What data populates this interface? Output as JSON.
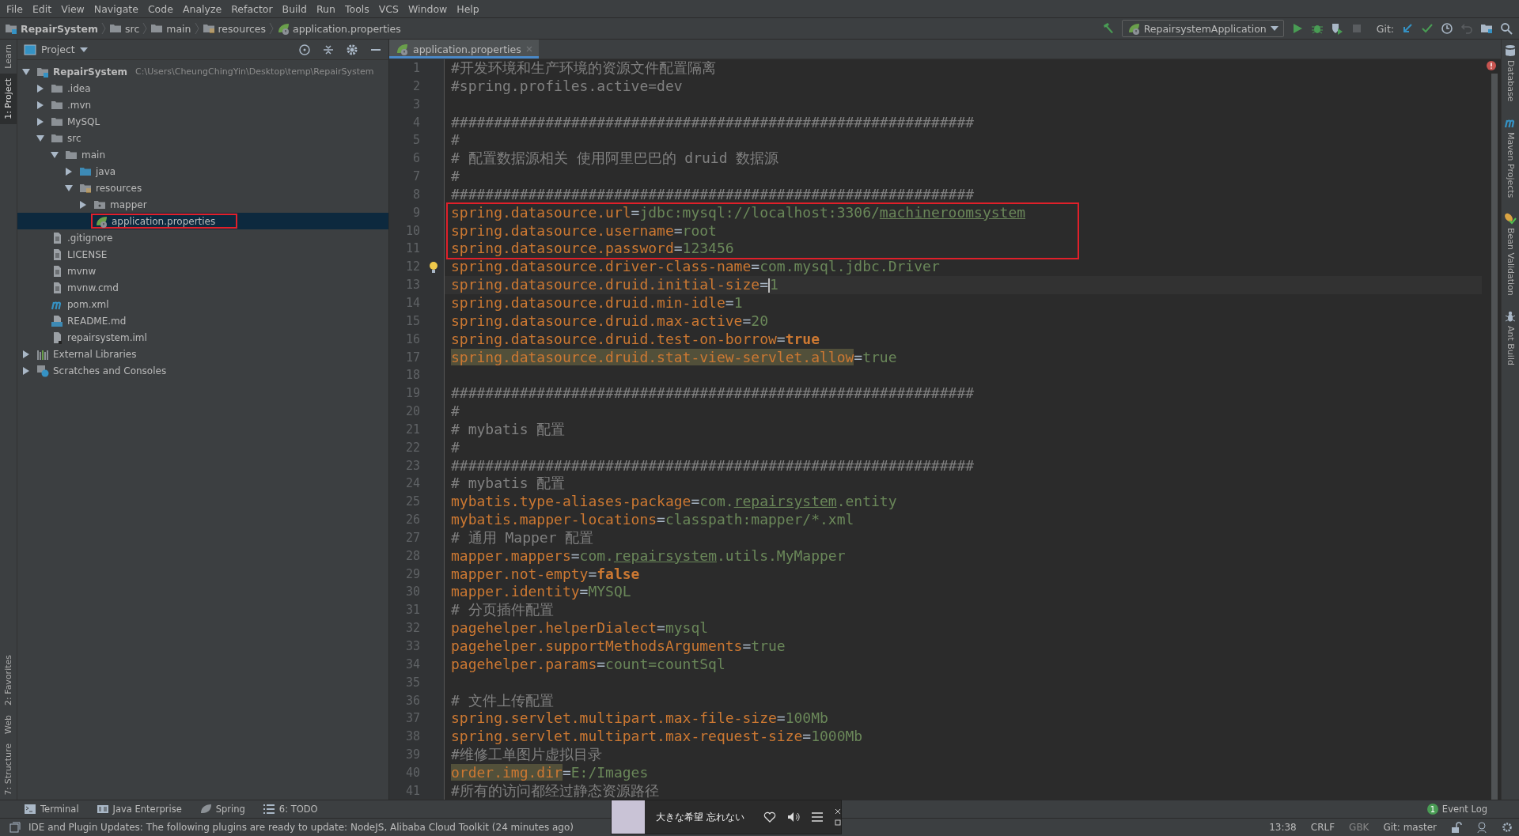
{
  "menu": [
    "File",
    "Edit",
    "View",
    "Navigate",
    "Code",
    "Analyze",
    "Refactor",
    "Build",
    "Run",
    "Tools",
    "VCS",
    "Window",
    "Help"
  ],
  "breadcrumbs": [
    {
      "label": "RepairSystem",
      "kind": "module"
    },
    {
      "label": "src",
      "kind": "folder"
    },
    {
      "label": "main",
      "kind": "folder"
    },
    {
      "label": "resources",
      "kind": "resource-folder"
    },
    {
      "label": "application.properties",
      "kind": "spring-file"
    }
  ],
  "toolbar": {
    "run_config": "RepairsystemApplication",
    "git_label": "Git:"
  },
  "left_stripe": [
    {
      "label": "Learn",
      "selected": false
    },
    {
      "label": "1: Project",
      "selected": true
    },
    {
      "label": "2: Favorites",
      "selected": false
    },
    {
      "label": "Web",
      "selected": false
    },
    {
      "label": "7: Structure",
      "selected": false
    }
  ],
  "project_panel": {
    "title": "Project",
    "tree": [
      {
        "label": "RepairSystem",
        "path": "C:\\Users\\CheungChingYin\\Desktop\\temp\\RepairSystem",
        "kind": "module",
        "expanded": true,
        "selected": false,
        "children": [
          {
            "label": ".idea",
            "kind": "folder",
            "expanded": false,
            "selected": false
          },
          {
            "label": ".mvn",
            "kind": "folder",
            "expanded": false,
            "selected": false
          },
          {
            "label": "MySQL",
            "kind": "folder",
            "expanded": false,
            "selected": false
          },
          {
            "label": "src",
            "kind": "folder",
            "expanded": true,
            "selected": false,
            "children": [
              {
                "label": "main",
                "kind": "folder",
                "expanded": true,
                "selected": false,
                "children": [
                  {
                    "label": "java",
                    "kind": "source-folder",
                    "expanded": false,
                    "selected": false
                  },
                  {
                    "label": "resources",
                    "kind": "resource-folder",
                    "expanded": true,
                    "selected": false,
                    "children": [
                      {
                        "label": "mapper",
                        "kind": "package-folder",
                        "expanded": false,
                        "selected": false
                      },
                      {
                        "label": "application.properties",
                        "kind": "spring-file",
                        "selected": true,
                        "boxed": true
                      }
                    ]
                  }
                ]
              }
            ]
          },
          {
            "label": ".gitignore",
            "kind": "file",
            "selected": false
          },
          {
            "label": "LICENSE",
            "kind": "file",
            "selected": false
          },
          {
            "label": "mvnw",
            "kind": "file",
            "selected": false
          },
          {
            "label": "mvnw.cmd",
            "kind": "file",
            "selected": false
          },
          {
            "label": "pom.xml",
            "kind": "maven",
            "selected": false
          },
          {
            "label": "README.md",
            "kind": "md",
            "selected": false
          },
          {
            "label": "repairsystem.iml",
            "kind": "iml",
            "selected": false
          }
        ]
      },
      {
        "label": "External Libraries",
        "kind": "libraries",
        "expanded": false,
        "selected": false
      },
      {
        "label": "Scratches and Consoles",
        "kind": "scratches",
        "expanded": false,
        "selected": false
      }
    ]
  },
  "editor": {
    "tabs": [
      {
        "label": "application.properties",
        "selected": true
      }
    ],
    "lines": [
      {
        "number": "1",
        "parts": [
          {
            "text": "#开发环境和生产环境的资源文件配置隔离",
            "kind": "comment"
          }
        ]
      },
      {
        "number": "2",
        "parts": [
          {
            "text": "#spring.profiles.active=dev",
            "kind": "comment"
          }
        ]
      },
      {
        "number": "3"
      },
      {
        "number": "4",
        "parts": [
          {
            "text": "#############################################################",
            "kind": "comment"
          }
        ]
      },
      {
        "number": "5",
        "parts": [
          {
            "text": "#",
            "kind": "comment"
          }
        ]
      },
      {
        "number": "6",
        "parts": [
          {
            "text": "# 配置数据源相关 使用阿里巴巴的 druid 数据源",
            "kind": "comment"
          }
        ]
      },
      {
        "number": "7",
        "parts": [
          {
            "text": "#",
            "kind": "comment"
          }
        ]
      },
      {
        "number": "8",
        "parts": [
          {
            "text": "#############################################################",
            "kind": "comment"
          }
        ]
      },
      {
        "number": "9",
        "boxed": true,
        "parts": [
          {
            "text": "spring.datasource.url",
            "kind": "key"
          },
          {
            "text": "=",
            "kind": "sep"
          },
          {
            "text": "jdbc:mysql://localhost:3306/",
            "kind": "value"
          },
          {
            "text": "machineroomsystem",
            "kind": "underlined"
          }
        ]
      },
      {
        "number": "10",
        "boxed": true,
        "parts": [
          {
            "text": "spring.datasource.username",
            "kind": "key"
          },
          {
            "text": "=",
            "kind": "sep"
          },
          {
            "text": "root",
            "kind": "value"
          }
        ]
      },
      {
        "number": "11",
        "boxed": true,
        "parts": [
          {
            "text": "spring.datasource.password",
            "kind": "key"
          },
          {
            "text": "=",
            "kind": "sep"
          },
          {
            "text": "123456",
            "kind": "value"
          }
        ]
      },
      {
        "number": "12",
        "bulb": true,
        "parts": [
          {
            "text": "spring.datasource.driver-class-name",
            "kind": "key"
          },
          {
            "text": "=",
            "kind": "sep"
          },
          {
            "text": "com.mysql.jdbc.Driver",
            "kind": "value"
          }
        ]
      },
      {
        "number": "13",
        "current": true,
        "parts": [
          {
            "text": "spring.datasource.druid.initial-size",
            "kind": "key"
          },
          {
            "text": "=",
            "kind": "sep"
          },
          {
            "text": "1",
            "kind": "value"
          }
        ]
      },
      {
        "number": "14",
        "parts": [
          {
            "text": "spring.datasource.druid.min-idle",
            "kind": "key"
          },
          {
            "text": "=",
            "kind": "sep"
          },
          {
            "text": "1",
            "kind": "value"
          }
        ]
      },
      {
        "number": "15",
        "parts": [
          {
            "text": "spring.datasource.druid.max-active",
            "kind": "key"
          },
          {
            "text": "=",
            "kind": "sep"
          },
          {
            "text": "20",
            "kind": "value"
          }
        ]
      },
      {
        "number": "16",
        "parts": [
          {
            "text": "spring.datasource.druid.test-on-borrow",
            "kind": "key"
          },
          {
            "text": "=",
            "kind": "sep"
          },
          {
            "text": "true",
            "kind": "keyword"
          }
        ]
      },
      {
        "number": "17",
        "parts": [
          {
            "text": "spring.datasource.druid.stat-view-servlet.allow",
            "kind": "key-highlight"
          },
          {
            "text": "=",
            "kind": "sep"
          },
          {
            "text": "true",
            "kind": "value"
          }
        ]
      },
      {
        "number": "18"
      },
      {
        "number": "19",
        "parts": [
          {
            "text": "#############################################################",
            "kind": "comment"
          }
        ]
      },
      {
        "number": "20",
        "parts": [
          {
            "text": "#",
            "kind": "comment"
          }
        ]
      },
      {
        "number": "21",
        "parts": [
          {
            "text": "# mybatis 配置",
            "kind": "comment"
          }
        ]
      },
      {
        "number": "22",
        "parts": [
          {
            "text": "#",
            "kind": "comment"
          }
        ]
      },
      {
        "number": "23",
        "parts": [
          {
            "text": "#############################################################",
            "kind": "comment"
          }
        ]
      },
      {
        "number": "24",
        "parts": [
          {
            "text": "# mybatis 配置",
            "kind": "comment"
          }
        ]
      },
      {
        "number": "25",
        "parts": [
          {
            "text": "mybatis.type-aliases-package",
            "kind": "key"
          },
          {
            "text": "=",
            "kind": "sep"
          },
          {
            "text": "com.",
            "kind": "value"
          },
          {
            "text": "repairsystem",
            "kind": "underlined"
          },
          {
            "text": ".entity",
            "kind": "value"
          }
        ]
      },
      {
        "number": "26",
        "parts": [
          {
            "text": "mybatis.mapper-locations",
            "kind": "key"
          },
          {
            "text": "=",
            "kind": "sep"
          },
          {
            "text": "classpath:mapper/*.xml",
            "kind": "value"
          }
        ]
      },
      {
        "number": "27",
        "parts": [
          {
            "text": "# 通用 Mapper 配置",
            "kind": "comment"
          }
        ]
      },
      {
        "number": "28",
        "parts": [
          {
            "text": "mapper.mappers",
            "kind": "key"
          },
          {
            "text": "=",
            "kind": "sep"
          },
          {
            "text": "com.",
            "kind": "value"
          },
          {
            "text": "repairsystem",
            "kind": "underlined"
          },
          {
            "text": ".utils.MyMapper",
            "kind": "value"
          }
        ]
      },
      {
        "number": "29",
        "parts": [
          {
            "text": "mapper.not-empty",
            "kind": "key"
          },
          {
            "text": "=",
            "kind": "sep"
          },
          {
            "text": "false",
            "kind": "keyword"
          }
        ]
      },
      {
        "number": "30",
        "parts": [
          {
            "text": "mapper.identity",
            "kind": "key"
          },
          {
            "text": "=",
            "kind": "sep"
          },
          {
            "text": "MYSQL",
            "kind": "value"
          }
        ]
      },
      {
        "number": "31",
        "parts": [
          {
            "text": "# 分页插件配置",
            "kind": "comment"
          }
        ]
      },
      {
        "number": "32",
        "parts": [
          {
            "text": "pagehelper.helperDialect",
            "kind": "key"
          },
          {
            "text": "=",
            "kind": "sep"
          },
          {
            "text": "mysql",
            "kind": "value"
          }
        ]
      },
      {
        "number": "33",
        "parts": [
          {
            "text": "pagehelper.supportMethodsArguments",
            "kind": "key"
          },
          {
            "text": "=",
            "kind": "sep"
          },
          {
            "text": "true",
            "kind": "value"
          }
        ]
      },
      {
        "number": "34",
        "parts": [
          {
            "text": "pagehelper.params",
            "kind": "key"
          },
          {
            "text": "=",
            "kind": "sep"
          },
          {
            "text": "count=countSql",
            "kind": "value"
          }
        ]
      },
      {
        "number": "35"
      },
      {
        "number": "36",
        "parts": [
          {
            "text": "# 文件上传配置",
            "kind": "comment"
          }
        ]
      },
      {
        "number": "37",
        "parts": [
          {
            "text": "spring.servlet.multipart.max-file-size",
            "kind": "key"
          },
          {
            "text": "=",
            "kind": "sep"
          },
          {
            "text": "100Mb",
            "kind": "value"
          }
        ]
      },
      {
        "number": "38",
        "parts": [
          {
            "text": "spring.servlet.multipart.max-request-size",
            "kind": "key"
          },
          {
            "text": "=",
            "kind": "sep"
          },
          {
            "text": "1000Mb",
            "kind": "value"
          }
        ]
      },
      {
        "number": "39",
        "parts": [
          {
            "text": "#维修工单图片虚拟目录",
            "kind": "comment"
          }
        ]
      },
      {
        "number": "40",
        "parts": [
          {
            "text": "order.img.dir",
            "kind": "key-highlight"
          },
          {
            "text": "=",
            "kind": "sep"
          },
          {
            "text": "E:/Images",
            "kind": "value"
          }
        ]
      },
      {
        "number": "41",
        "parts": [
          {
            "text": "#所有的访问都经过静态资源路径",
            "kind": "comment"
          }
        ]
      }
    ]
  },
  "right_stripe": [
    {
      "label": "Database",
      "kind": "database"
    },
    {
      "label": "Maven Projects",
      "kind": "maven"
    },
    {
      "label": "Bean Validation",
      "kind": "bean"
    },
    {
      "label": "Ant Build",
      "kind": "ant"
    }
  ],
  "tool_tabs": [
    {
      "label": "Terminal",
      "kind": "terminal"
    },
    {
      "label": "Java Enterprise",
      "kind": "javaee"
    },
    {
      "label": "Spring",
      "kind": "spring"
    },
    {
      "label": "6: TODO",
      "kind": "todo"
    }
  ],
  "event_log": {
    "label": "Event Log",
    "count": "1"
  },
  "status_bar": {
    "message": "IDE and Plugin Updates: The following plugins are ready to update: NodeJS, Alibaba Cloud Toolkit (24 minutes ago)",
    "position": "13:38",
    "line_separator": "CRLF",
    "encoding": "GBK",
    "branch": "Git: master"
  },
  "music_popup": {
    "title": "大きな希望 忘れない"
  }
}
